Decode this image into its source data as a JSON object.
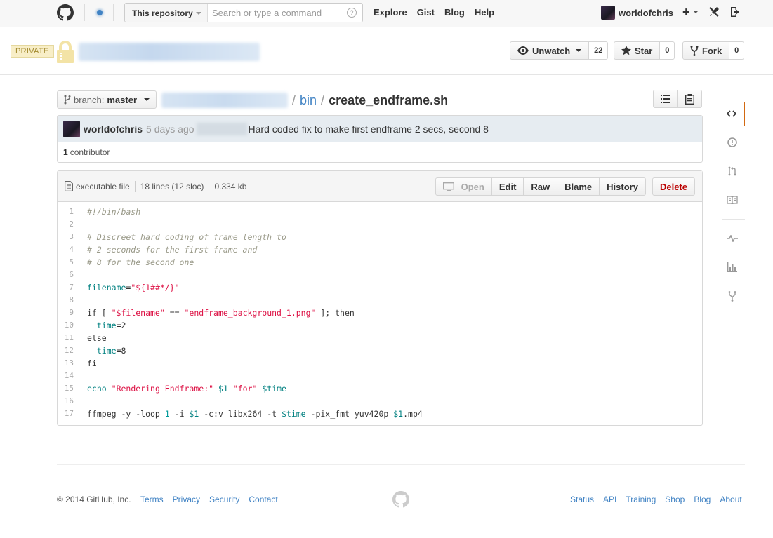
{
  "header": {
    "search_scope": "This repository",
    "search_placeholder": "Search or type a command",
    "search_help": "?",
    "nav": [
      "Explore",
      "Gist",
      "Blog",
      "Help"
    ],
    "username": "worldofchris",
    "plus": "+"
  },
  "repo": {
    "private_label": "PRIVATE",
    "watch_label": "Unwatch",
    "watch_count": "22",
    "star_label": "Star",
    "star_count": "0",
    "fork_label": "Fork",
    "fork_count": "0"
  },
  "filenav": {
    "branch_label": "branch:",
    "branch_value": "master",
    "sep1": "/",
    "dir": "bin",
    "sep2": "/",
    "file": "create_endframe.sh"
  },
  "commit": {
    "author": "worldofchris",
    "time": "5 days ago",
    "message": "Hard coded fix to make first endframe 2 secs, second 8",
    "contributor_count": "1",
    "contributor_label": "contributor"
  },
  "file": {
    "type": "executable file",
    "lines": "18 lines (12 sloc)",
    "size": "0.334 kb",
    "buttons": {
      "open": "Open",
      "edit": "Edit",
      "raw": "Raw",
      "blame": "Blame",
      "history": "History",
      "delete": "Delete"
    }
  },
  "code_lines": [
    {
      "n": "1",
      "parts": [
        [
          "com",
          "#!/bin/bash"
        ]
      ]
    },
    {
      "n": "2",
      "parts": []
    },
    {
      "n": "3",
      "parts": [
        [
          "com",
          "# Discreet hard coding of frame length to"
        ]
      ]
    },
    {
      "n": "4",
      "parts": [
        [
          "com",
          "# 2 seconds for the first frame and"
        ]
      ]
    },
    {
      "n": "5",
      "parts": [
        [
          "com",
          "# 8 for the second one"
        ]
      ]
    },
    {
      "n": "6",
      "parts": []
    },
    {
      "n": "7",
      "parts": [
        [
          "var",
          "filename"
        ],
        [
          "kw",
          "="
        ],
        [
          "str",
          "\"${1##*/}\""
        ]
      ]
    },
    {
      "n": "8",
      "parts": []
    },
    {
      "n": "9",
      "parts": [
        [
          "kw",
          "if [ "
        ],
        [
          "str",
          "\"$filename\""
        ],
        [
          "kw",
          " == "
        ],
        [
          "str",
          "\"endframe_background_1.png\""
        ],
        [
          "kw",
          " ]; then"
        ]
      ]
    },
    {
      "n": "10",
      "parts": [
        [
          "kw",
          "  "
        ],
        [
          "var",
          "time"
        ],
        [
          "kw",
          "=2"
        ]
      ]
    },
    {
      "n": "11",
      "parts": [
        [
          "kw",
          "else"
        ]
      ]
    },
    {
      "n": "12",
      "parts": [
        [
          "kw",
          "  "
        ],
        [
          "var",
          "time"
        ],
        [
          "kw",
          "=8"
        ]
      ]
    },
    {
      "n": "13",
      "parts": [
        [
          "kw",
          "fi"
        ]
      ]
    },
    {
      "n": "14",
      "parts": []
    },
    {
      "n": "15",
      "parts": [
        [
          "var",
          "echo"
        ],
        [
          "kw",
          " "
        ],
        [
          "str",
          "\"Rendering Endframe:\""
        ],
        [
          "kw",
          " "
        ],
        [
          "var",
          "$1"
        ],
        [
          "kw",
          " "
        ],
        [
          "str",
          "\"for\""
        ],
        [
          "kw",
          " "
        ],
        [
          "var",
          "$time"
        ]
      ]
    },
    {
      "n": "16",
      "parts": []
    },
    {
      "n": "17",
      "parts": [
        [
          "kw",
          "ffmpeg -y -loop "
        ],
        [
          "num",
          "1"
        ],
        [
          "kw",
          " -i "
        ],
        [
          "var",
          "$1"
        ],
        [
          "kw",
          " -c:v libx264 -t "
        ],
        [
          "var",
          "$time"
        ],
        [
          "kw",
          " -pix_fmt yuv420p "
        ],
        [
          "var",
          "$1"
        ],
        [
          "kw",
          ".mp4"
        ]
      ]
    }
  ],
  "footer": {
    "copyright": "© 2014 GitHub, Inc.",
    "left_links": [
      "Terms",
      "Privacy",
      "Security",
      "Contact"
    ],
    "right_links": [
      "Status",
      "API",
      "Training",
      "Shop",
      "Blog",
      "About"
    ]
  },
  "colors": {
    "link": "#4183c4",
    "private_bg": "#f8eec7",
    "delete": "#bb0000",
    "active_tab": "#d26911"
  },
  "icons": {
    "sidebar": [
      "code-icon",
      "issues-icon",
      "pull-request-icon",
      "wiki-icon",
      "pulse-icon",
      "graphs-icon",
      "network-icon"
    ]
  }
}
